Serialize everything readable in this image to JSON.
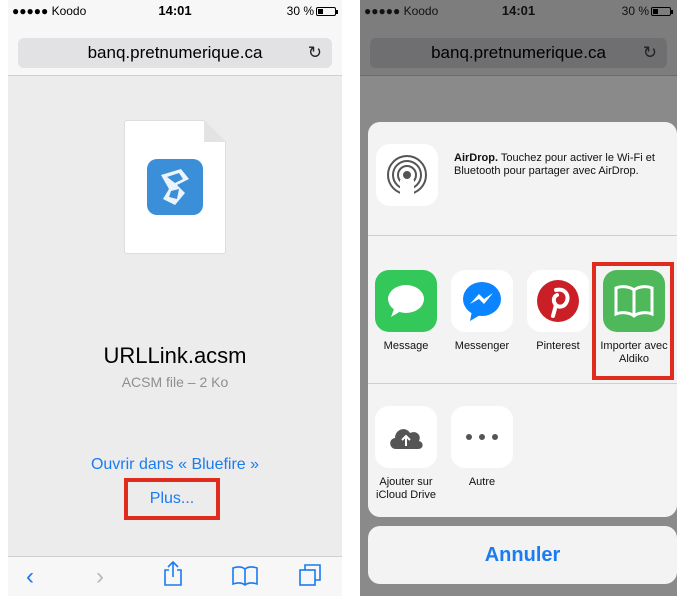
{
  "status": {
    "carrier": "●●●●● Koodo",
    "time": "14:01",
    "battery": "30 %"
  },
  "browser": {
    "url": "banq.pretnumerique.ca",
    "reload_icon": "reload-icon"
  },
  "left": {
    "file_name": "URLLink.acsm",
    "file_meta": "ACSM file – 2 Ko",
    "open_in": "Ouvrir dans « Bluefire »",
    "more": "Plus..."
  },
  "toolbar_icons": [
    "back-icon",
    "forward-icon",
    "share-icon",
    "bookmarks-icon",
    "tabs-icon"
  ],
  "share_sheet": {
    "airdrop_title": "AirDrop.",
    "airdrop_text": "Touchez pour activer le Wi-Fi et Bluetooth pour partager avec AirDrop.",
    "apps": [
      {
        "label": "Message",
        "color": "#34c759"
      },
      {
        "label": "Messenger",
        "color": "#0a84ff"
      },
      {
        "label": "Pinterest",
        "color": "#cb1f27"
      },
      {
        "label": "Importer avec Aldiko",
        "color": "#4fb85a"
      }
    ],
    "actions": [
      {
        "label": "Ajouter sur iCloud Drive"
      },
      {
        "label": "Autre"
      }
    ],
    "cancel": "Annuler"
  },
  "colors": {
    "accent": "#1a7cf0",
    "highlight": "#e02b1f"
  }
}
